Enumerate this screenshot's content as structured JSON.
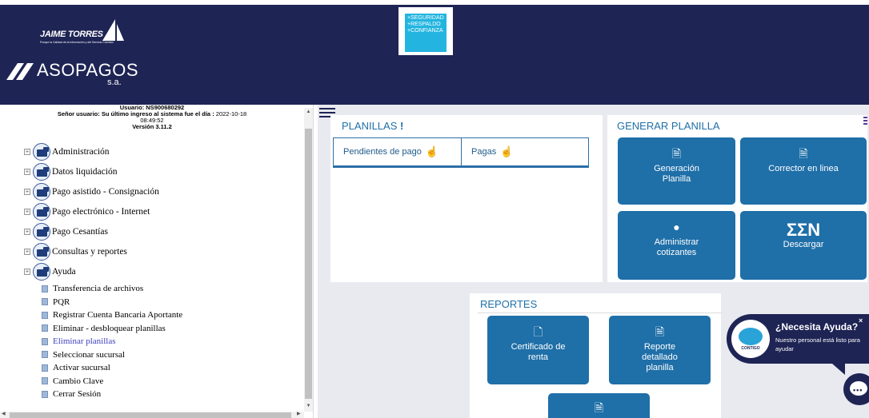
{
  "header": {
    "brand1_name": "JAIME TORRES",
    "brand1_tagline": "Porque la Calidad de la Información y del Servicio Cuentan",
    "brand2_name": "ASOPAGOS",
    "brand2_suffix": "s.a.",
    "ad_lines": [
      "+SEGURIDAD",
      "+RESPALDO",
      "+CONFIANZA"
    ]
  },
  "sidebar": {
    "user_line": "Usuario: NS900680292",
    "last_login_label": "Señor usuario: Su último ingreso al sistema fue el día :",
    "last_login_date": "2022-10-18",
    "last_login_time": "08:49:52",
    "version": "Versión 3.11.2",
    "tree_items": [
      {
        "label": "Administración"
      },
      {
        "label": "Datos liquidación"
      },
      {
        "label": "Pago asistido - Consignación"
      },
      {
        "label": "Pago electrónico - Internet"
      },
      {
        "label": "Pago Cesantías"
      },
      {
        "label": "Consultas y reportes"
      },
      {
        "label": "Ayuda"
      }
    ],
    "plain_items": [
      {
        "label": "Transferencia de archivos"
      },
      {
        "label": "PQR"
      },
      {
        "label": "Registrar Cuenta Bancaria Aportante"
      },
      {
        "label": "Eliminar - desbloquear planillas"
      },
      {
        "label": "Eliminar planillas"
      },
      {
        "label": "Seleccionar sucursal"
      },
      {
        "label": "Activar sucursal"
      },
      {
        "label": "Cambio Clave"
      },
      {
        "label": "Cerrar Sesión"
      }
    ]
  },
  "main": {
    "planillas": {
      "title": "PLANILLAS",
      "tab_pending": "Pendientes de pago",
      "tab_paid": "Pagas"
    },
    "generar": {
      "title": "GENERAR PLANILLA",
      "tile_generacion": "Generación Planilla",
      "tile_corrector": "Corrector en linea",
      "tile_administrar": "Administrar cotizantes",
      "tile_descargar_icon": "ΣΣN",
      "tile_descargar": "Descargar"
    },
    "reportes": {
      "title": "REPORTES",
      "tile_certificado": "Certificado de renta",
      "tile_reporte": "Reporte detallado planilla"
    }
  },
  "help": {
    "title": "¿Necesita Ayuda?",
    "text": "Nuestro personal está listo para ayudar",
    "logo_text": "CONTIGO",
    "close": "×"
  },
  "colors": {
    "header_bg": "#1e2454",
    "tile_blue": "#1f6fa8",
    "title_blue": "#1f6fa8",
    "main_bg": "#e8eaf0"
  }
}
